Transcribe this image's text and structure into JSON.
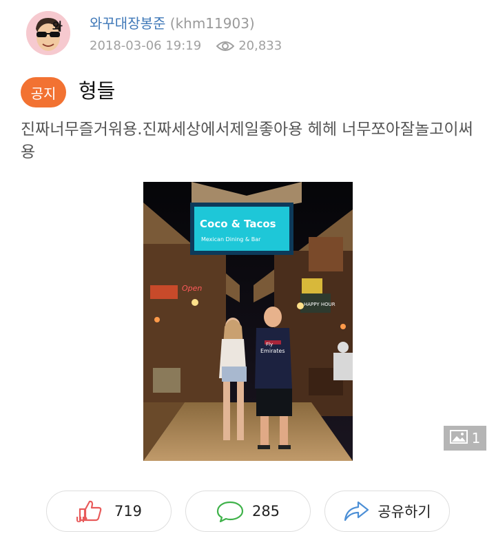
{
  "post": {
    "author_name": "와꾸대장봉준",
    "author_id": "(khm11903)",
    "date": "2018-03-06 19:19",
    "views": "20,833",
    "badge": "공지",
    "title": "형들",
    "body": "진짜너무즐거워용.진짜세상에서제일좋아용 헤헤 너무쪼아잘놀고이써용"
  },
  "photo": {
    "sign_line1": "Coco & Tacos",
    "sign_line2": "Mexican Dining & Bar",
    "neon_left": "Open",
    "jersey_line1": "Fly",
    "jersey_line2": "Emirates",
    "chalkboard": "HAPPY HOUR",
    "image_count": "1"
  },
  "actions": {
    "up_label": "UP",
    "up_count": "719",
    "comment_count": "285",
    "share_label": "공유하기"
  },
  "colors": {
    "author": "#3f78b8",
    "badge": "#f27232",
    "up": "#e85a5a",
    "comment": "#3fb24a",
    "share": "#4c8fd6"
  }
}
